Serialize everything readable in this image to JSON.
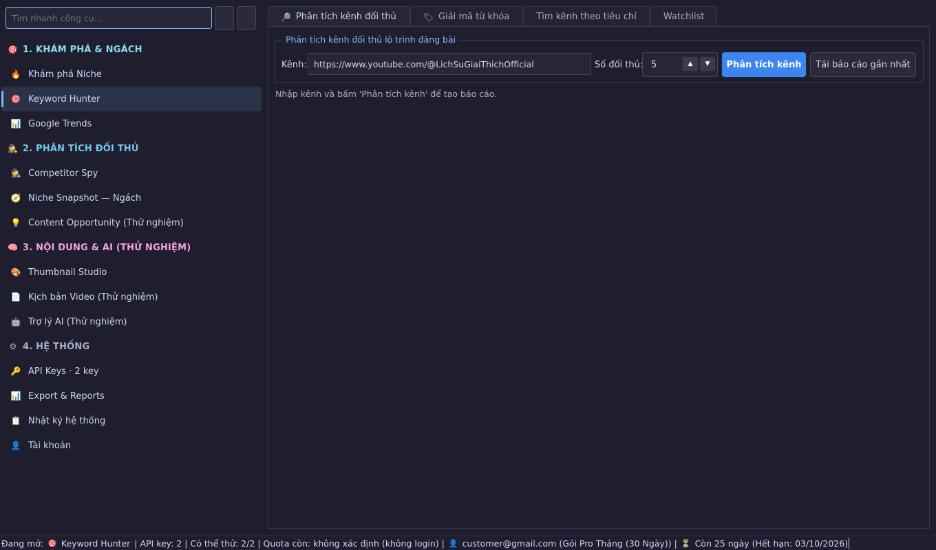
{
  "sidebar": {
    "search_placeholder": "Tìm nhanh công cụ...",
    "sections": [
      {
        "icon": "🎯",
        "label": "1. KHÁM PHÁ & NGÁCH",
        "items": [
          {
            "icon": "🔥",
            "label": "Khám phá Niche"
          },
          {
            "icon": "🎯",
            "label": "Keyword Hunter",
            "active": true
          },
          {
            "icon": "📊",
            "label": "Google Trends"
          }
        ]
      },
      {
        "icon": "🕵",
        "label": "2. PHÂN TÍCH ĐỐI THỦ",
        "items": [
          {
            "icon": "🕵",
            "label": "Competitor Spy"
          },
          {
            "icon": "🧭",
            "label": "Niche Snapshot — Ngách"
          },
          {
            "icon": "💡",
            "label": "Content Opportunity (Thử nghiệm)"
          }
        ]
      },
      {
        "icon": "🧠",
        "label": "3. NỘI DUNG & AI (THỬ NGHIỆM)",
        "items": [
          {
            "icon": "🎨",
            "label": "Thumbnail Studio"
          },
          {
            "icon": "📄",
            "label": "Kịch bản Video (Thử nghiệm)"
          },
          {
            "icon": "🤖",
            "label": "Trợ lý AI (Thử nghiệm)"
          }
        ]
      },
      {
        "icon": "⚙",
        "label": "4. HỆ THỐNG",
        "items": [
          {
            "icon": "🔑",
            "label": "API Keys · 2 key"
          },
          {
            "icon": "📊",
            "label": "Export & Reports"
          },
          {
            "icon": "📋",
            "label": "Nhật ký hệ thống"
          },
          {
            "icon": "👤",
            "label": "Tài khoản"
          }
        ]
      }
    ]
  },
  "tabs": [
    {
      "icon": "🔎",
      "label": "Phân tích kênh đối thủ",
      "active": true
    },
    {
      "icon": "🏷",
      "label": "Giải mã từ khóa"
    },
    {
      "icon": "",
      "label": "Tìm kênh theo tiêu chí"
    },
    {
      "icon": "",
      "label": "Watchlist"
    }
  ],
  "main": {
    "group_title": "Phân tích kênh đối thủ  lộ trình đăng bài",
    "channel_label": "Kênh:",
    "channel_value": "https://www.youtube.com/@LichSuGiaiThichOfficial",
    "competitors_label": "Số đối thủ:",
    "competitors_value": "5",
    "analyze_button": "Phân tích kênh",
    "download_button": "Tải báo cáo gần nhất",
    "hint": "Nhập kênh và bấm 'Phân tích kênh' để tạo báo cáo."
  },
  "statusbar": {
    "open_label": "Đang mở:",
    "open_icon": "🎯",
    "open_value": "Keyword Hunter",
    "rest_1": "|  API key: 2  |  Có thể thử: 2/2  |  Quota còn: không xác định (không login)  |",
    "user_icon": "👤",
    "user": "customer@gmail.com (Gói Pro Tháng (30 Ngày))  |",
    "timer_icon": "⏳",
    "remaining": "Còn 25 ngày (Hết hạn: 03/10/2026)"
  },
  "colors": {
    "accent": "#89b4fa",
    "primary_button": "#3d86f0",
    "background": "#1e1e2e"
  }
}
